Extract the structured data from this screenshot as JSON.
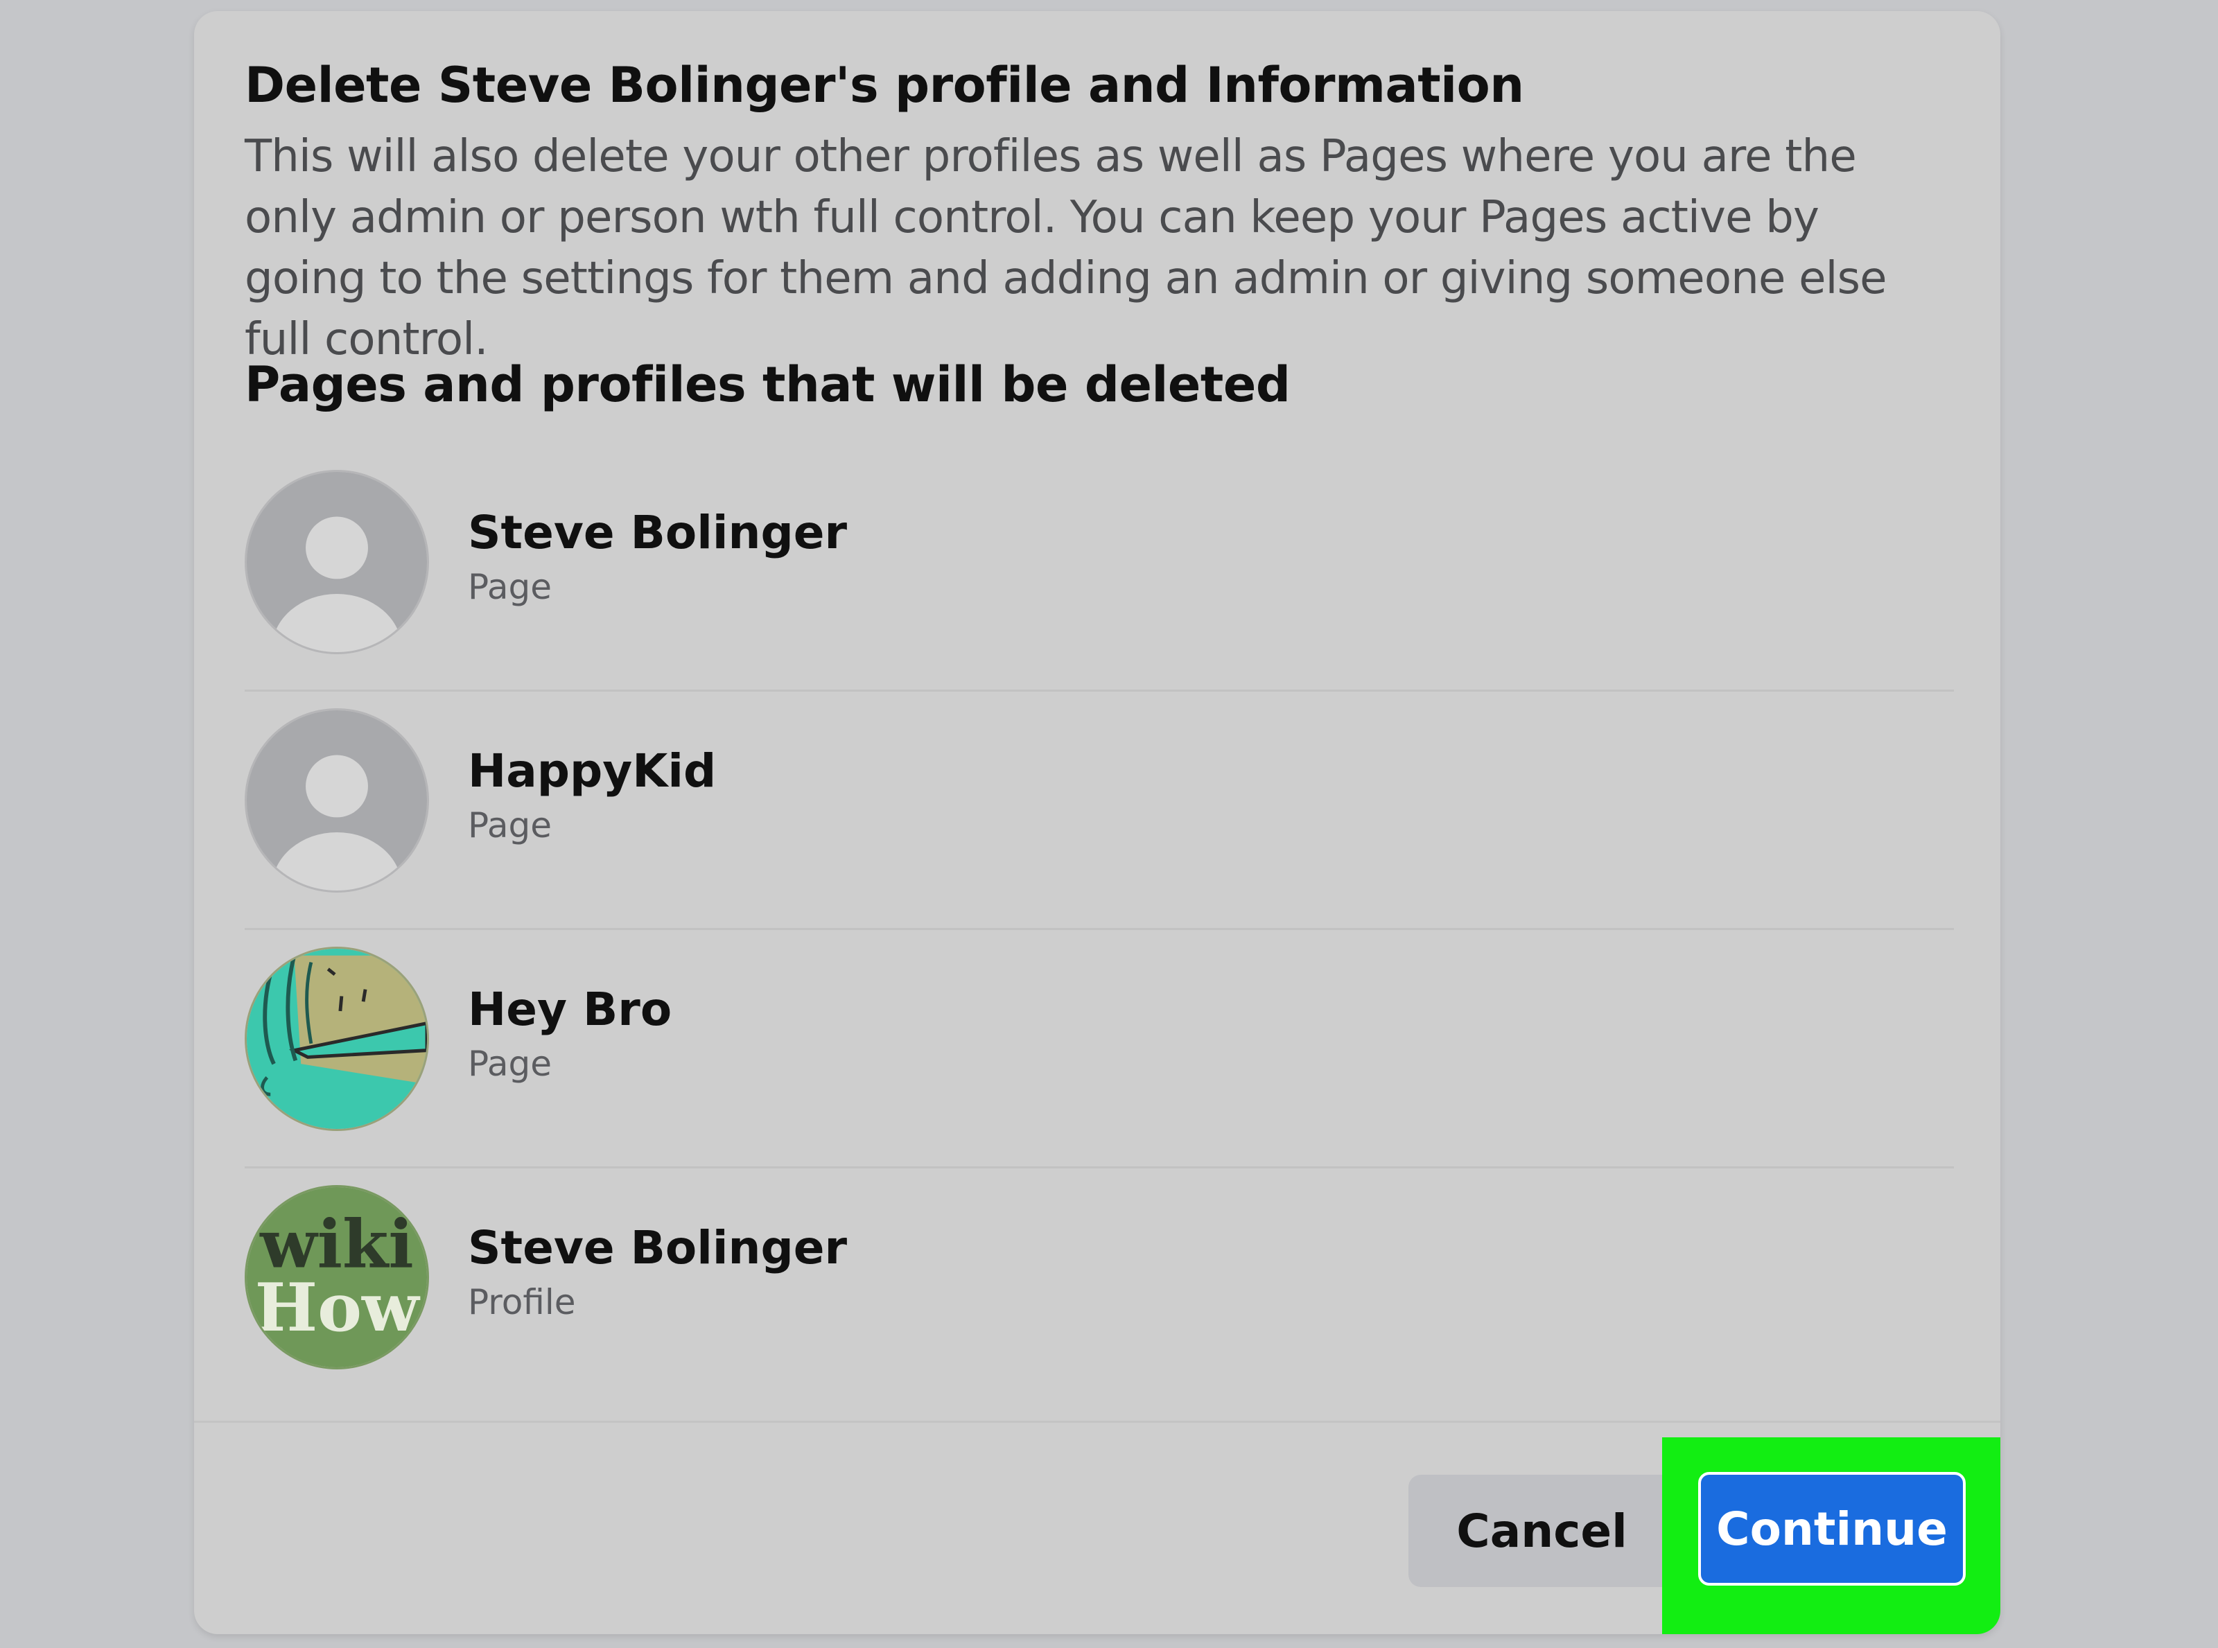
{
  "dialog": {
    "title": "Delete Steve Bolinger's profile and Information",
    "description": "This will also delete your other profiles as well as Pages where you are the only admin or person wth full control. You can keep your Pages active by going to the settings for them and adding an admin or giving someone else full control.",
    "section_title": "Pages and profiles that will be deleted",
    "items": [
      {
        "name": "Steve Bolinger",
        "type": "Page",
        "avatar": "default-person-avatar"
      },
      {
        "name": "HappyKid",
        "type": "Page",
        "avatar": "default-person-avatar"
      },
      {
        "name": "Hey Bro",
        "type": "Page",
        "avatar": "illustrated-avatar"
      },
      {
        "name": "Steve Bolinger",
        "type": "Profile",
        "avatar": "wikihow-logo-avatar",
        "logo_text_top": "wiki",
        "logo_text_bottom": "How"
      }
    ],
    "buttons": {
      "cancel": "Cancel",
      "continue": "Continue"
    }
  },
  "colors": {
    "background": "#c5c6c9",
    "dialog": "#cecece",
    "primary": "#1a6cdf",
    "highlight": "#12ee12",
    "cancel_button": "#bfc0c4"
  }
}
